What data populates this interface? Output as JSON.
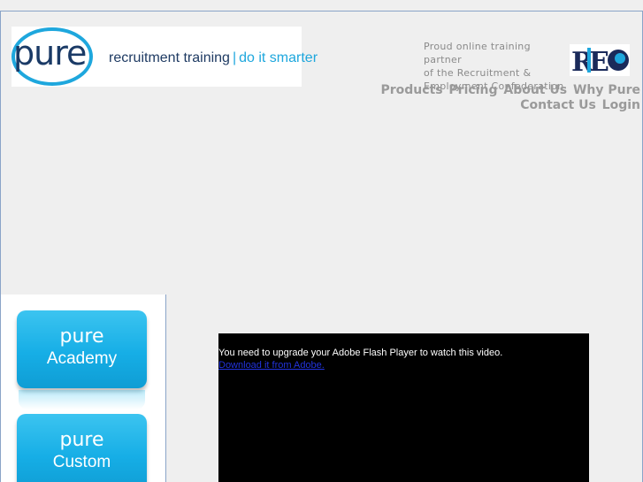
{
  "logo": {
    "word": "pure",
    "tagline_main": "recruitment training",
    "tagline_sep": "|",
    "tagline_smart": "do it smarter"
  },
  "partner": {
    "line1": "Proud online training partner",
    "line2": "of the Recruitment &",
    "line3": "Employment Confederation"
  },
  "nav": {
    "items": [
      "Products",
      "Pricing",
      "About Us",
      "Why Pure",
      "Contact Us",
      "Login"
    ]
  },
  "sidebar": {
    "buttons": [
      {
        "line1": "pure",
        "line2": "Academy"
      },
      {
        "line1": "pure",
        "line2": "Custom"
      }
    ]
  },
  "video": {
    "message": "You need to upgrade your Adobe Flash Player to watch this video.",
    "link": "Download it from Adobe."
  },
  "colors": {
    "brand_navy": "#1a3a66",
    "brand_cyan": "#1ea7dd",
    "button_blue": "#16aee6",
    "nav_gray": "#9a9a9a"
  }
}
